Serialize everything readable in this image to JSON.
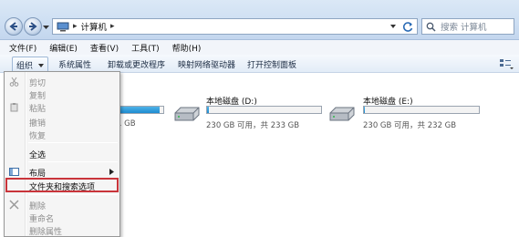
{
  "address_bar": {
    "separator": "▸",
    "path": "计算机",
    "search_placeholder": "搜索 计算机"
  },
  "menubar": {
    "items": [
      "文件(F)",
      "编辑(E)",
      "查看(V)",
      "工具(T)",
      "帮助(H)"
    ]
  },
  "command_bar": {
    "organize": "组织",
    "items": [
      "系统属性",
      "卸载或更改程序",
      "映射网络驱动器",
      "打开控制面板"
    ]
  },
  "drives": [
    {
      "size_text": "1 GB",
      "usage": 0.95
    },
    {
      "name": "本地磁盘 (D:)",
      "size_text": "230 GB 可用，共 233 GB",
      "usage": 0.013
    },
    {
      "name": "本地磁盘 (E:)",
      "size_text": "230 GB 可用，共 232 GB",
      "usage": 0.009
    }
  ],
  "organize_menu": {
    "cut": "剪切",
    "copy": "复制",
    "paste": "粘贴",
    "undo": "撤销",
    "redo": "恢复",
    "select_all": "全选",
    "layout": "布局",
    "folder_options": "文件夹和搜索选项",
    "delete": "删除",
    "rename": "重命名",
    "remove_properties": "删除属性"
  },
  "colors": {
    "highlight_border": "#c9343a",
    "drive_bar": "#1d8bd0"
  }
}
